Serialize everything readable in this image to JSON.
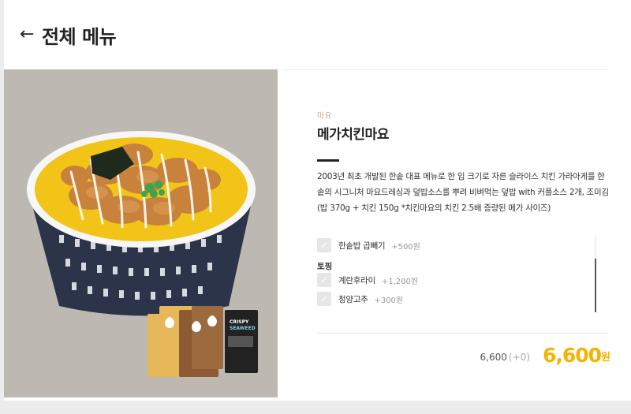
{
  "header": {
    "back_icon": "arrow-left-icon",
    "title": "전체 메뉴"
  },
  "product": {
    "category": "마요",
    "name": "메가치킨마요",
    "description": "2003년 최초 개발된 한솥 대표 메뉴로 한 입 크기로 자른 슬라이스 치킨 가라아게를 한솥의 시그니처 마요드레싱과 덮밥소스를 뿌려 비벼먹는 덮밥 with 커플소스 2개, 조미김 (밥 370g + 치킨 150g *치킨마요의 치킨 2.5배 증량된 메가 사이즈)",
    "image_alt": "메가치킨마요 덮밥"
  },
  "options": {
    "rice_upgrade": {
      "label": "한솥밥 곱빼기",
      "price": "+500원"
    },
    "topping_group": "토핑",
    "toppings": [
      {
        "label": "계란후라이",
        "price": "+1,200원"
      },
      {
        "label": "청양고추",
        "price": "+300원"
      }
    ]
  },
  "pricing": {
    "base": "6,600",
    "extra": "(+0)",
    "total": "6,600",
    "currency": "원"
  },
  "packets": {
    "crispy_1": "CRISPY",
    "crispy_2": "SEAWEED"
  },
  "colors": {
    "accent": "#f4b400",
    "image_bg": "#bdb9b2",
    "category": "#c8ab96"
  }
}
